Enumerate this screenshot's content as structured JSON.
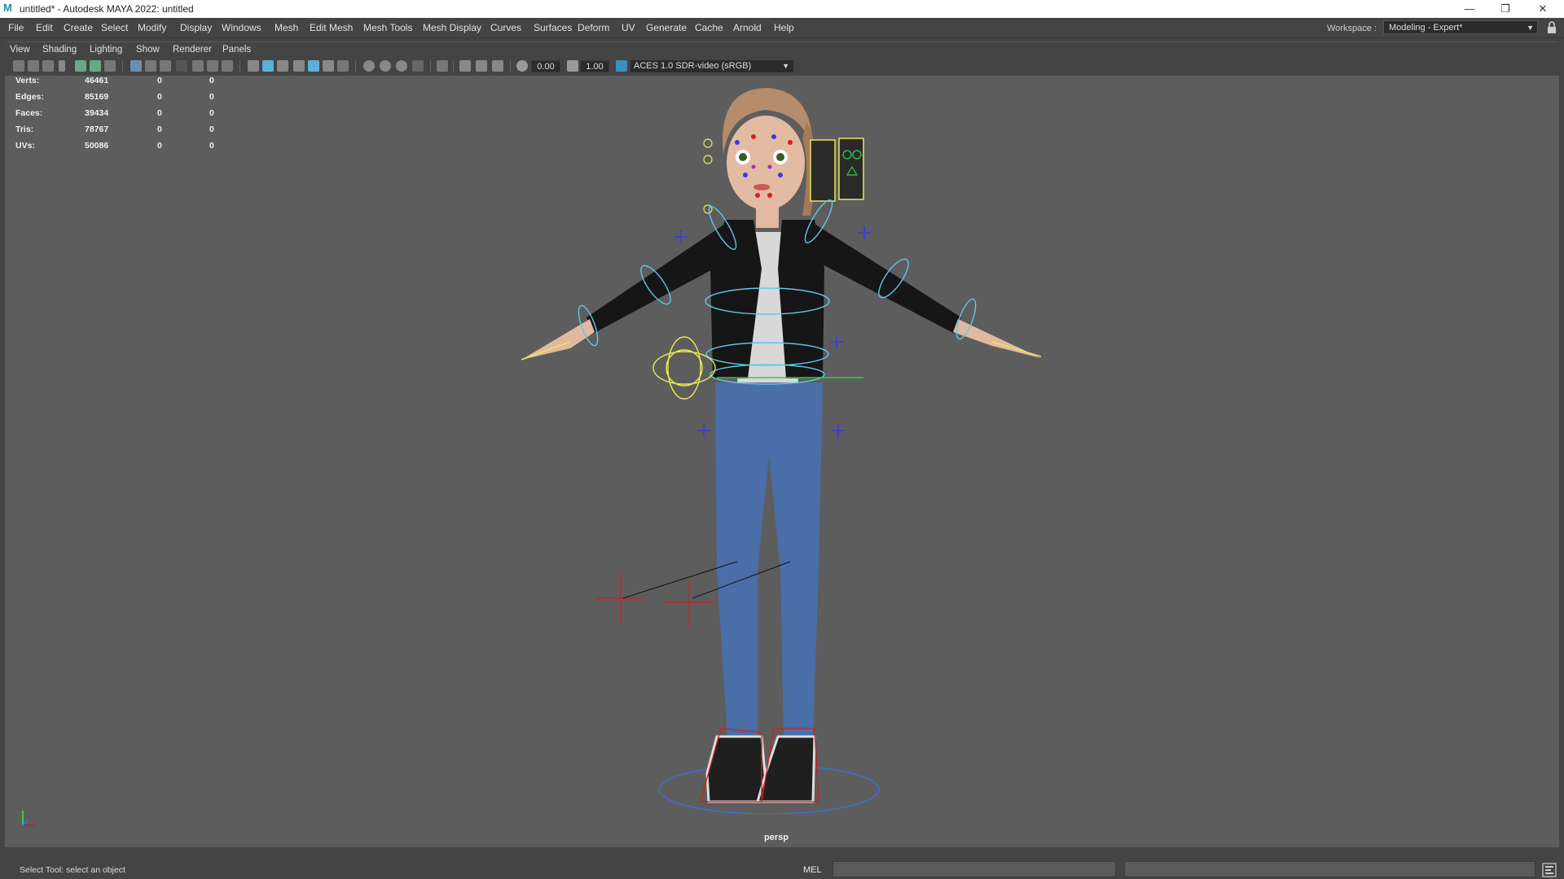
{
  "window": {
    "title": "untitled* - Autodesk MAYA 2022: untitled",
    "app_icon": "maya-logo-icon",
    "controls": [
      "minimize-icon",
      "restore-icon",
      "close-icon"
    ]
  },
  "menubar": {
    "items": [
      "File",
      "Edit",
      "Create",
      "Select",
      "Modify",
      "Display",
      "Windows",
      "Mesh",
      "Edit Mesh",
      "Mesh Tools",
      "Mesh Display",
      "Curves",
      "Surfaces",
      "Deform",
      "UV",
      "Generate",
      "Cache",
      "Arnold",
      "Help"
    ],
    "workspace_label": "Workspace :",
    "workspace_value": "Modeling - Expert*"
  },
  "panel_menu": {
    "items": [
      "View",
      "Shading",
      "Lighting",
      "Show",
      "Renderer",
      "Panels"
    ]
  },
  "panel_toolbar": {
    "exposure": "0.00",
    "gamma": "1.00",
    "color_space": "ACES 1.0 SDR-video (sRGB)"
  },
  "hud": {
    "rows": [
      {
        "label": "Verts:",
        "v1": "46461",
        "v2": "0",
        "v3": "0"
      },
      {
        "label": "Edges:",
        "v1": "85169",
        "v2": "0",
        "v3": "0"
      },
      {
        "label": "Faces:",
        "v1": "39434",
        "v2": "0",
        "v3": "0"
      },
      {
        "label": "Tris:",
        "v1": "78767",
        "v2": "0",
        "v3": "0"
      },
      {
        "label": "UVs:",
        "v1": "50086",
        "v2": "0",
        "v3": "0"
      }
    ]
  },
  "viewport": {
    "camera": "persp",
    "background_color": "#5d5d5d"
  },
  "statusbar": {
    "help_line": "Select Tool: select an object",
    "command_language": "MEL"
  },
  "colors": {
    "rig_cyan": "#5fc8e8",
    "rig_yellow": "#e8e85a",
    "rig_blue": "#3a3ae0",
    "rig_red": "#d02020",
    "jacket": "#1a1a1a",
    "jeans": "#4a6ea8"
  }
}
